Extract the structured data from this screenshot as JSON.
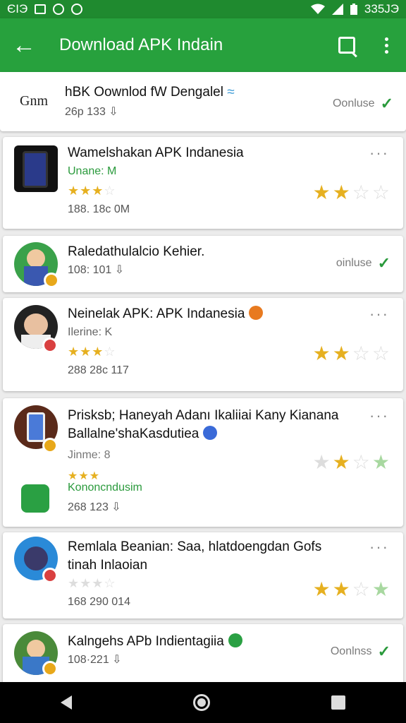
{
  "status_bar": {
    "left_text": "ЄІЭ",
    "time": "335ЈЭ",
    "icons": [
      "notification-box-icon",
      "messenger-icon",
      "location-icon",
      "wifi-icon",
      "signal-icon",
      "battery-icon"
    ]
  },
  "app_bar": {
    "title": "Download APK Indain",
    "back_icon": "back-arrow-icon",
    "search_icon": "search-icon",
    "menu_icon": "more-vert-icon"
  },
  "apps": [
    {
      "logo_text": "Gnm",
      "name": "hBK Oownlod fW Dengalel",
      "meta": "26p 133",
      "action": "Oonluse"
    },
    {
      "name": "Wamelshakan APK Indanesia",
      "sub": "Unane: M",
      "meta": "188. 18c 0M",
      "small_rating": 3,
      "large_rating": 2
    },
    {
      "name": "Raledathulalcio Kehier.",
      "meta": "108: 101",
      "action": "oinluse"
    },
    {
      "name": "Neinelak APK: APK Indanesia",
      "sub": "Ilerine: K",
      "meta": "288  28c 117",
      "small_rating": 3,
      "large_rating": 2
    },
    {
      "name": "Prisksb; Haneyah Adanı Ikaliiai Kany Kianana",
      "name2": "Ballalne'shaKasdutiea",
      "sub": "Jinme: 8",
      "sub2": "Kononcndusim",
      "meta": "268 123",
      "small_rating": 3,
      "large_rating": 2
    },
    {
      "name": "Remlala Beanian: Saa, hlatdoengdan Gofs",
      "name2": "tinah Inlaoian",
      "meta": "168  290 014",
      "small_rating": 0,
      "large_rating": 2
    },
    {
      "name": "Kalngehs APb Indientagiia",
      "meta": "108·221",
      "action": "Oonlnss"
    }
  ],
  "colors": {
    "status_bar": "#1f8a2f",
    "app_bar": "#27a13d",
    "install_green": "#2a9a3c",
    "star_gold": "#e6b020"
  },
  "nav_bar": {
    "back_icon": "nav-back-icon",
    "home_icon": "nav-home-icon",
    "recents_icon": "nav-recents-icon"
  }
}
